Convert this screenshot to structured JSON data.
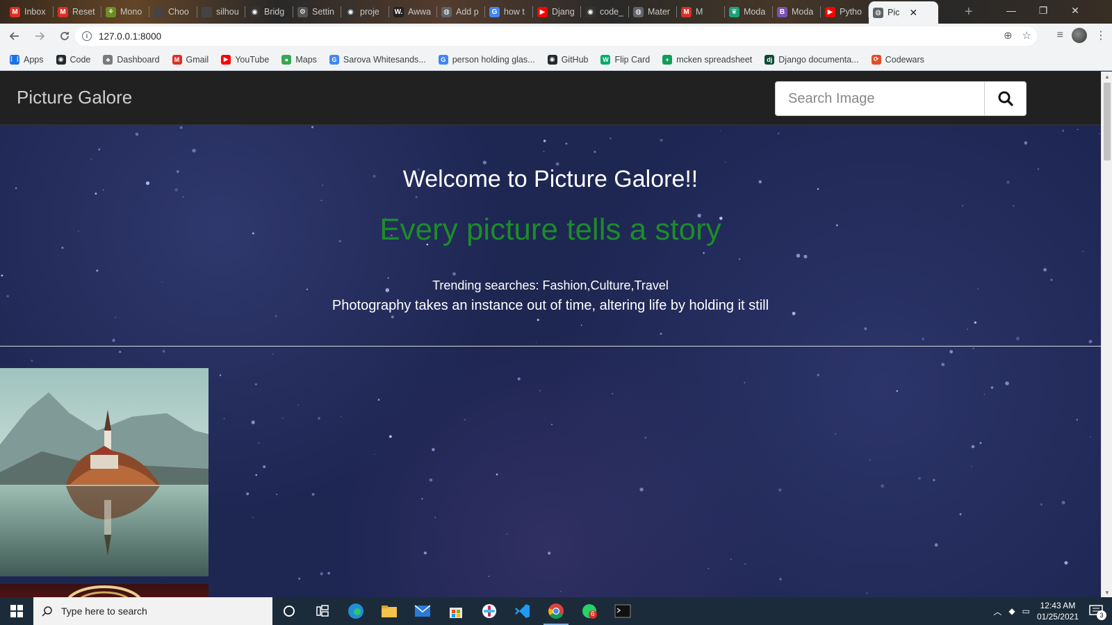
{
  "browser": {
    "tabs": [
      {
        "label": "Inbox",
        "icon": "gmail-icon",
        "color": "#d93025",
        "glyph": "M"
      },
      {
        "label": "Reset",
        "icon": "gmail-icon",
        "color": "#d93025",
        "glyph": "M"
      },
      {
        "label": "Mono",
        "icon": "leaf-icon",
        "color": "#6b8e23",
        "glyph": "⚘"
      },
      {
        "label": "Choo",
        "icon": "page-icon",
        "color": "#444444",
        "glyph": ""
      },
      {
        "label": "silhou",
        "icon": "page-icon",
        "color": "#444444",
        "glyph": ""
      },
      {
        "label": "Bridg",
        "icon": "github-icon",
        "color": "#333333",
        "glyph": "◉"
      },
      {
        "label": "Settin",
        "icon": "gear-icon",
        "color": "#555555",
        "glyph": "⚙"
      },
      {
        "label": "proje",
        "icon": "github-icon",
        "color": "#333333",
        "glyph": "◉"
      },
      {
        "label": "Awwa",
        "icon": "awwwards-icon",
        "color": "#222222",
        "glyph": "W."
      },
      {
        "label": "Add p",
        "icon": "globe-icon",
        "color": "#5f6368",
        "glyph": "◍"
      },
      {
        "label": "how t",
        "icon": "google-icon",
        "color": "#4285f4",
        "glyph": "G"
      },
      {
        "label": "Djang",
        "icon": "youtube-icon",
        "color": "#ff0000",
        "glyph": "▶"
      },
      {
        "label": "code_",
        "icon": "github-icon",
        "color": "#333333",
        "glyph": "◉"
      },
      {
        "label": "Mater",
        "icon": "globe-icon",
        "color": "#5f6368",
        "glyph": "◍"
      },
      {
        "label": "M",
        "icon": "gmail-icon",
        "color": "#d93025",
        "glyph": "M"
      },
      {
        "label": "Moda",
        "icon": "leaf-icon",
        "color": "#1aa37a",
        "glyph": "❦"
      },
      {
        "label": "Moda",
        "icon": "bootstrap-icon",
        "color": "#7952b3",
        "glyph": "B"
      },
      {
        "label": "Pytho",
        "icon": "youtube-icon",
        "color": "#ff0000",
        "glyph": "▶"
      },
      {
        "label": "Pic",
        "icon": "globe-icon",
        "color": "#5f6368",
        "glyph": "◍",
        "active": true
      }
    ],
    "address": "127.0.0.1:8000",
    "bookmarks": [
      {
        "label": "Apps",
        "icon": "apps-grid-icon",
        "color": "#1a73e8",
        "glyph": "⋮⋮"
      },
      {
        "label": "Code",
        "icon": "github-icon",
        "color": "#24292e",
        "glyph": "◉"
      },
      {
        "label": "Dashboard",
        "icon": "tree-icon",
        "color": "#7a7a7a",
        "glyph": "♣"
      },
      {
        "label": "Gmail",
        "icon": "gmail-icon",
        "color": "#d93025",
        "glyph": "M"
      },
      {
        "label": "YouTube",
        "icon": "youtube-icon",
        "color": "#ff0000",
        "glyph": "▶"
      },
      {
        "label": "Maps",
        "icon": "maps-pin-icon",
        "color": "#34a853",
        "glyph": "●"
      },
      {
        "label": "Sarova Whitesands...",
        "icon": "google-icon",
        "color": "#4285f4",
        "glyph": "G"
      },
      {
        "label": "person holding glas...",
        "icon": "google-icon",
        "color": "#4285f4",
        "glyph": "G"
      },
      {
        "label": "GitHub",
        "icon": "github-icon",
        "color": "#24292e",
        "glyph": "◉"
      },
      {
        "label": "Flip Card",
        "icon": "w3schools-icon",
        "color": "#04aa6d",
        "glyph": "W"
      },
      {
        "label": "mcken spreadsheet",
        "icon": "sheets-icon",
        "color": "#0f9d58",
        "glyph": "+"
      },
      {
        "label": "Django documenta...",
        "icon": "django-icon",
        "color": "#0c4b33",
        "glyph": "dj"
      },
      {
        "label": "Codewars",
        "icon": "codewars-icon",
        "color": "#e34c26",
        "glyph": "⟳"
      }
    ]
  },
  "site": {
    "brand": "Picture Galore",
    "search_placeholder": "Search Image",
    "welcome": "Welcome to Picture Galore!!",
    "tagline": "Every picture tells a story",
    "trending": "Trending searches: Fashion,Culture,Travel",
    "quote": "Photography takes an instance out of time, altering life by holding it still"
  },
  "taskbar": {
    "search_placeholder": "Type here to search",
    "time": "12:43 AM",
    "date": "01/25/2021",
    "notification_count": "3",
    "whatsapp_badge": "6"
  },
  "colors": {
    "tagline": "#1c8c2a",
    "navbar": "#212121",
    "page_bg": "#1e2652",
    "taskbar": "#1c2b3a"
  }
}
